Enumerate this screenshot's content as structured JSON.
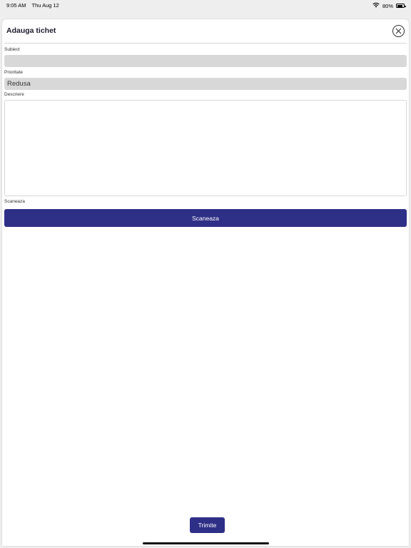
{
  "status_bar": {
    "time": "9:05 AM",
    "date": "Thu Aug 12",
    "battery": "80%",
    "battery_level": 0.8,
    "wifi_icon": "wifi-icon",
    "battery_icon": "battery-icon"
  },
  "header": {
    "title": "Adauga tichet",
    "close_icon": "close-icon"
  },
  "form": {
    "subject": {
      "label": "Subiect",
      "value": ""
    },
    "priority": {
      "label": "Prioritate",
      "value": "Redusa"
    },
    "description": {
      "label": "Descriere",
      "value": ""
    },
    "scan": {
      "label": "Scaneaza",
      "button_label": "Scaneaza"
    }
  },
  "footer": {
    "submit_label": "Trimite"
  },
  "colors": {
    "accent": "#2e2f86",
    "field_bg": "#d8d8d8"
  }
}
